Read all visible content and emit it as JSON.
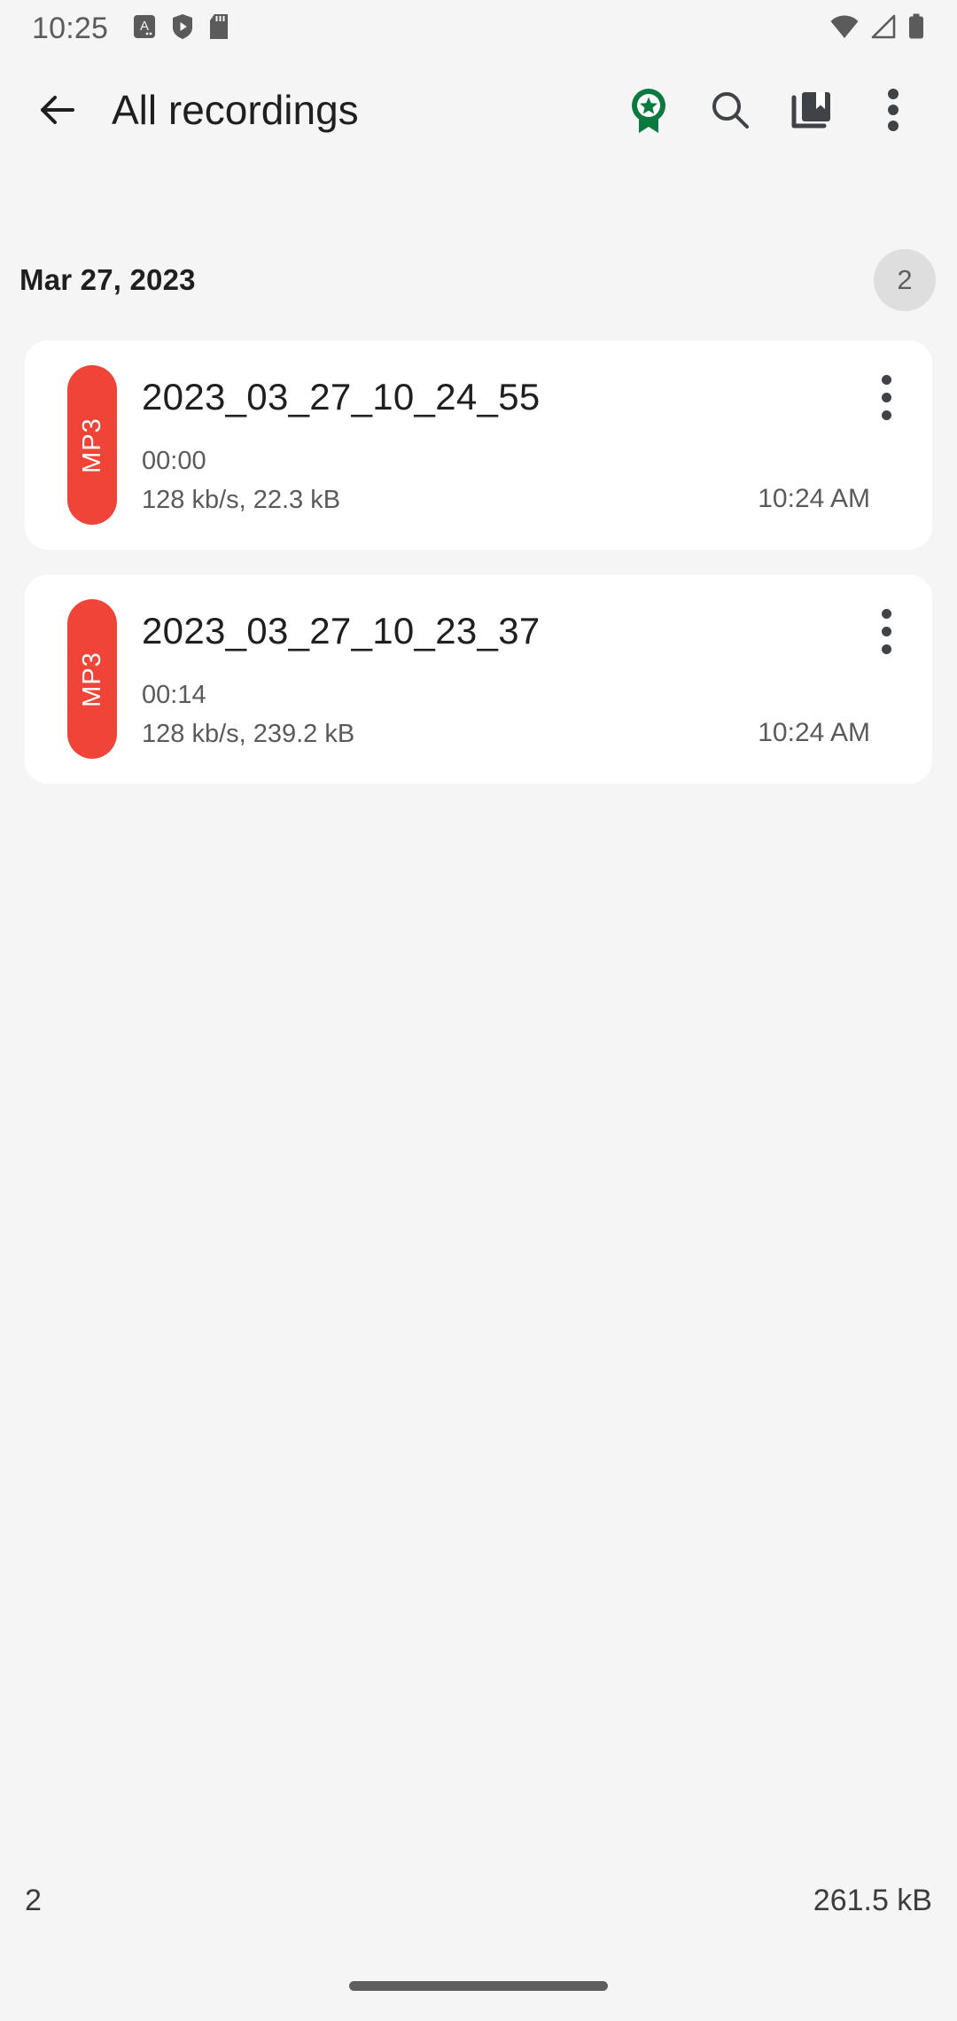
{
  "status_bar": {
    "clock": "10:25",
    "left_icons": [
      "notification-a-icon",
      "play-shield-icon",
      "sd-card-icon"
    ],
    "right_icons": [
      "wifi-icon",
      "cellular-signal-icon",
      "battery-icon"
    ]
  },
  "app_bar": {
    "back_label": "Back",
    "title": "All recordings",
    "actions": [
      {
        "name": "award-badge-icon",
        "label": "Premium"
      },
      {
        "name": "search-icon",
        "label": "Search"
      },
      {
        "name": "collections-icon",
        "label": "Collections"
      },
      {
        "name": "overflow-menu-icon",
        "label": "More options"
      }
    ]
  },
  "date_group": {
    "date": "Mar 27, 2023",
    "count": "2"
  },
  "recordings": [
    {
      "format": "MP3",
      "title": "2023_03_27_10_24_55",
      "duration": "00:00",
      "meta": "128 kb/s, 22.3 kB",
      "time": "10:24 AM"
    },
    {
      "format": "MP3",
      "title": "2023_03_27_10_23_37",
      "duration": "00:14",
      "meta": "128 kb/s, 239.2 kB",
      "time": "10:24 AM"
    }
  ],
  "bottom_bar": {
    "count": "2",
    "total_size": "261.5 kB"
  },
  "colors": {
    "background": "#F5F5F5",
    "card": "#FFFFFF",
    "mp3_badge": "#F04438",
    "award_green": "#0B7A3E",
    "text_primary": "#1F1F1F",
    "text_secondary": "#5A5A5A",
    "count_chip": "#DEDEDE"
  }
}
